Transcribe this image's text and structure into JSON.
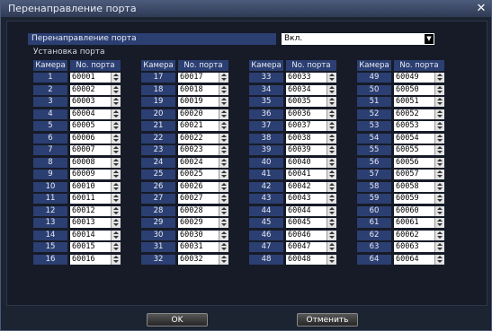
{
  "window": {
    "title": "Перенаправление порта",
    "close_glyph": "✕"
  },
  "forwarding": {
    "label": "Перенаправление порта",
    "value": "Вкл."
  },
  "setup_label": "Установка порта",
  "headers": {
    "camera": "Камера",
    "port": "No. порта"
  },
  "groups": [
    {
      "rows": [
        {
          "camera": "1",
          "port": "60001"
        },
        {
          "camera": "2",
          "port": "60002"
        },
        {
          "camera": "3",
          "port": "60003"
        },
        {
          "camera": "4",
          "port": "60004"
        },
        {
          "camera": "5",
          "port": "60005"
        },
        {
          "camera": "6",
          "port": "60006"
        },
        {
          "camera": "7",
          "port": "60007"
        },
        {
          "camera": "8",
          "port": "60008"
        },
        {
          "camera": "9",
          "port": "60009"
        },
        {
          "camera": "10",
          "port": "60010"
        },
        {
          "camera": "11",
          "port": "60011"
        },
        {
          "camera": "12",
          "port": "60012"
        },
        {
          "camera": "13",
          "port": "60013"
        },
        {
          "camera": "14",
          "port": "60014"
        },
        {
          "camera": "15",
          "port": "60015"
        },
        {
          "camera": "16",
          "port": "60016"
        }
      ]
    },
    {
      "rows": [
        {
          "camera": "17",
          "port": "60017"
        },
        {
          "camera": "18",
          "port": "60018"
        },
        {
          "camera": "19",
          "port": "60019"
        },
        {
          "camera": "20",
          "port": "60020"
        },
        {
          "camera": "21",
          "port": "60021"
        },
        {
          "camera": "22",
          "port": "60022"
        },
        {
          "camera": "23",
          "port": "60023"
        },
        {
          "camera": "24",
          "port": "60024"
        },
        {
          "camera": "25",
          "port": "60025"
        },
        {
          "camera": "26",
          "port": "60026"
        },
        {
          "camera": "27",
          "port": "60027"
        },
        {
          "camera": "28",
          "port": "60028"
        },
        {
          "camera": "29",
          "port": "60029"
        },
        {
          "camera": "30",
          "port": "60030"
        },
        {
          "camera": "31",
          "port": "60031"
        },
        {
          "camera": "32",
          "port": "60032"
        }
      ]
    },
    {
      "rows": [
        {
          "camera": "33",
          "port": "60033"
        },
        {
          "camera": "34",
          "port": "60034"
        },
        {
          "camera": "35",
          "port": "60035"
        },
        {
          "camera": "36",
          "port": "60036"
        },
        {
          "camera": "37",
          "port": "60037"
        },
        {
          "camera": "38",
          "port": "60038"
        },
        {
          "camera": "39",
          "port": "60039"
        },
        {
          "camera": "40",
          "port": "60040"
        },
        {
          "camera": "41",
          "port": "60041"
        },
        {
          "camera": "42",
          "port": "60042"
        },
        {
          "camera": "43",
          "port": "60043"
        },
        {
          "camera": "44",
          "port": "60044"
        },
        {
          "camera": "45",
          "port": "60045"
        },
        {
          "camera": "46",
          "port": "60046"
        },
        {
          "camera": "47",
          "port": "60047"
        },
        {
          "camera": "48",
          "port": "60048"
        }
      ]
    },
    {
      "rows": [
        {
          "camera": "49",
          "port": "60049"
        },
        {
          "camera": "50",
          "port": "60050"
        },
        {
          "camera": "51",
          "port": "60051"
        },
        {
          "camera": "52",
          "port": "60052"
        },
        {
          "camera": "53",
          "port": "60053"
        },
        {
          "camera": "54",
          "port": "60054"
        },
        {
          "camera": "55",
          "port": "60055"
        },
        {
          "camera": "56",
          "port": "60056"
        },
        {
          "camera": "57",
          "port": "60057"
        },
        {
          "camera": "58",
          "port": "60058"
        },
        {
          "camera": "59",
          "port": "60059"
        },
        {
          "camera": "60",
          "port": "60060"
        },
        {
          "camera": "61",
          "port": "60061"
        },
        {
          "camera": "62",
          "port": "60062"
        },
        {
          "camera": "63",
          "port": "60063"
        },
        {
          "camera": "64",
          "port": "60064"
        }
      ]
    }
  ],
  "buttons": {
    "ok": "OK",
    "cancel": "Отменить"
  }
}
